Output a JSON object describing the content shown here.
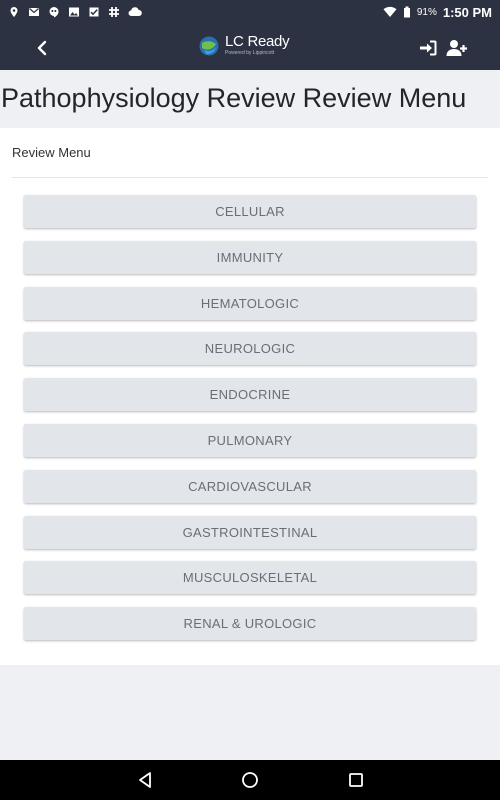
{
  "status_bar": {
    "battery_percent": "91%",
    "time": "1:50 PM",
    "notification_icons": [
      "location-icon",
      "gmail-icon",
      "hangouts-icon",
      "image-icon",
      "checkbox-icon",
      "slack-icon",
      "cloud-icon"
    ],
    "status_icons": [
      "wifi-icon",
      "battery-icon"
    ]
  },
  "app_bar": {
    "logo_name": "LC Ready",
    "logo_subtitle": "Powered by Lippincott",
    "actions": [
      "sign-in-icon",
      "add-user-icon"
    ]
  },
  "page": {
    "title": "Pathophysiology Review Review Menu"
  },
  "menu": {
    "header": "Review Menu",
    "items": [
      {
        "label": "CELLULAR"
      },
      {
        "label": "IMMUNITY"
      },
      {
        "label": "HEMATOLOGIC"
      },
      {
        "label": "NEUROLOGIC"
      },
      {
        "label": "ENDOCRINE"
      },
      {
        "label": "PULMONARY"
      },
      {
        "label": "CARDIOVASCULAR"
      },
      {
        "label": "GASTROINTESTINAL"
      },
      {
        "label": "MUSCULOSKELETAL"
      },
      {
        "label": "RENAL & UROLOGIC"
      }
    ]
  },
  "colors": {
    "app_bar": "#2d3243",
    "page_background": "#eef0f3",
    "button_background": "#e2e5ea",
    "button_text": "#6b6e74"
  }
}
